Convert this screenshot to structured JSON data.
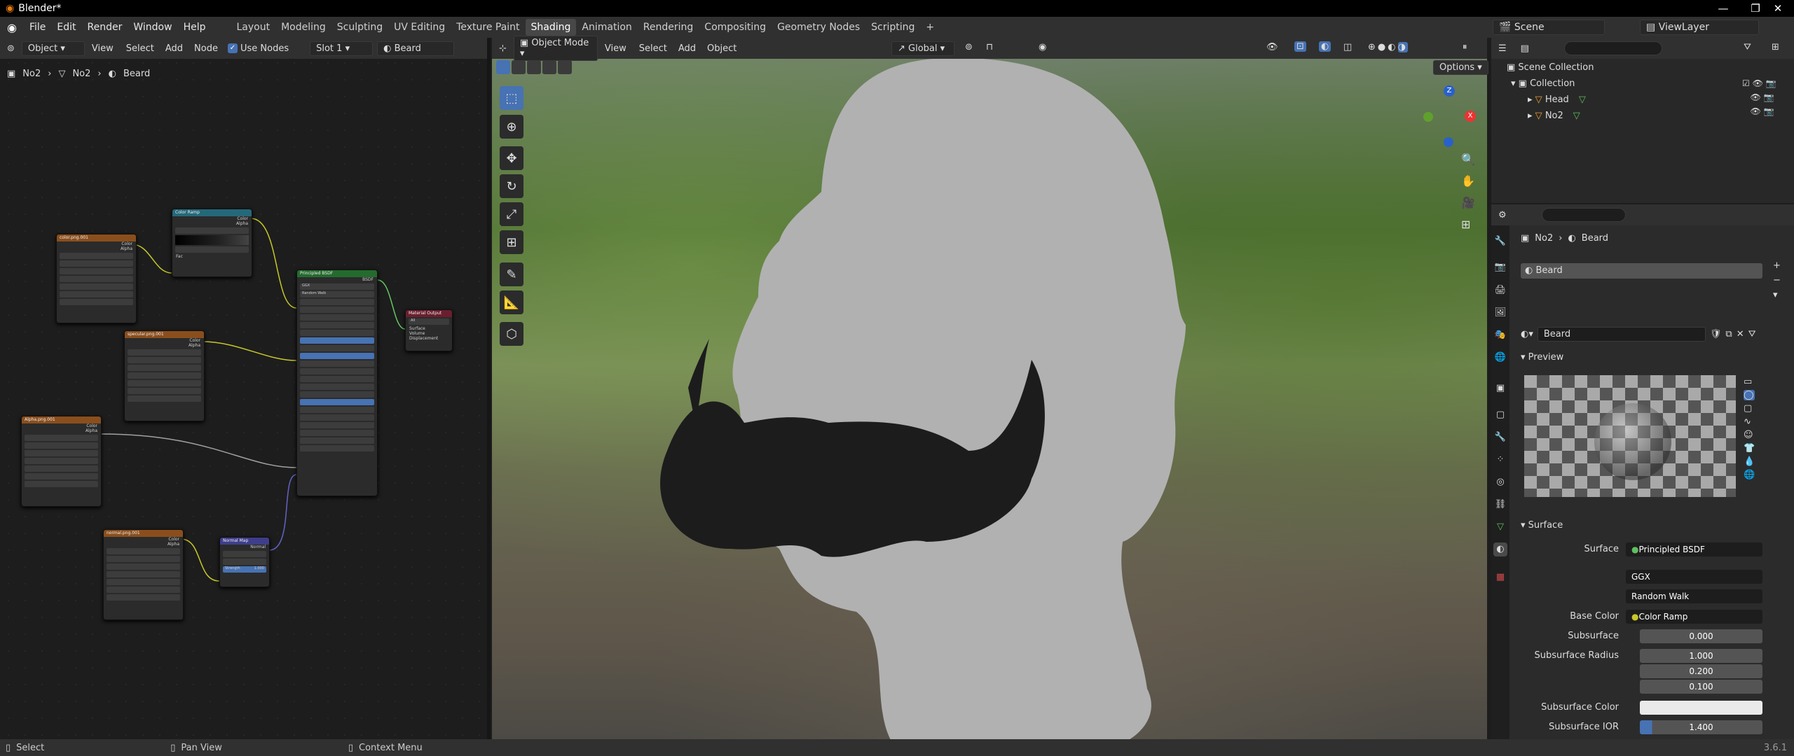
{
  "window": {
    "title": "Blender*",
    "min": "—",
    "max": "❐",
    "close": "✕"
  },
  "menu": [
    "File",
    "Edit",
    "Render",
    "Window",
    "Help"
  ],
  "workspaces": [
    "Layout",
    "Modeling",
    "Sculpting",
    "UV Editing",
    "Texture Paint",
    "Shading",
    "Animation",
    "Rendering",
    "Compositing",
    "Geometry Nodes",
    "Scripting"
  ],
  "workspace_add": "+",
  "top_right": {
    "scene": "Scene",
    "view_layer": "ViewLayer"
  },
  "node_editor": {
    "object_mode": "Object",
    "menus": [
      "View",
      "Select",
      "Add",
      "Node"
    ],
    "use_nodes_label": "Use Nodes",
    "slot": "Slot 1",
    "material": "Beard",
    "breadcrumb": [
      "No2",
      "No2",
      "Beard"
    ],
    "nodes": {
      "color_tex": {
        "title": "color.png.001",
        "outs": [
          "Color",
          "Alpha"
        ]
      },
      "color_ramp": {
        "title": "Color Ramp",
        "outs": [
          "Color",
          "Alpha"
        ],
        "in": "Fac"
      },
      "specular_tex": {
        "title": "specular.png.001",
        "outs": [
          "Color",
          "Alpha"
        ]
      },
      "alpha_tex": {
        "title": "Alpha.png.001",
        "outs": [
          "Color",
          "Alpha"
        ]
      },
      "normal_tex": {
        "title": "normal.png.001",
        "outs": [
          "Color",
          "Alpha"
        ]
      },
      "normal_map": {
        "title": "Normal Map",
        "outs": [
          "Normal"
        ],
        "strength_label": "Strength",
        "strength": "1.000"
      },
      "bsdf": {
        "title": "Principled BSDF",
        "out": "BSDF",
        "dist": "GGX",
        "sss": "Random Walk"
      },
      "output": {
        "title": "Material Output",
        "target": "All",
        "ins": [
          "Surface",
          "Volume",
          "Displacement"
        ]
      }
    }
  },
  "viewport": {
    "mode": "Object Mode",
    "menus": [
      "View",
      "Select",
      "Add",
      "Object"
    ],
    "transform": "Global",
    "options": "Options",
    "axes": {
      "x": "X",
      "y": "Y",
      "z": "Z"
    }
  },
  "outliner": {
    "search_placeholder": "",
    "items": [
      {
        "label": "Scene Collection"
      },
      {
        "label": "Collection"
      },
      {
        "label": "Head"
      },
      {
        "label": "No2"
      }
    ]
  },
  "properties": {
    "breadcrumb": [
      "No2",
      "Beard"
    ],
    "slot_name": "Beard",
    "material_name": "Beard",
    "preview_label": "Preview",
    "surface_label": "Surface",
    "surface_shader": "Principled BSDF",
    "distribution": "GGX",
    "subsurface_method": "Random Walk",
    "fields": [
      {
        "label": "Surface",
        "value": "Principled BSDF"
      },
      {
        "label": "Base Color",
        "value": "Color Ramp"
      },
      {
        "label": "Subsurface",
        "value": "0.000"
      },
      {
        "label": "Subsurface Radius",
        "value": "1.000"
      },
      {
        "label": "",
        "value": "0.200"
      },
      {
        "label": "",
        "value": "0.100"
      },
      {
        "label": "Subsurface Color",
        "value": ""
      },
      {
        "label": "Subsurface IOR",
        "value": "1.400"
      }
    ]
  },
  "status": {
    "select": "Select",
    "pan": "Pan View",
    "context": "Context Menu",
    "version": "3.6.1"
  },
  "colors": {
    "accent": "#4772b3",
    "active_ws": "#474747",
    "header": "#303030",
    "node_bg": "#1d1d1d"
  }
}
